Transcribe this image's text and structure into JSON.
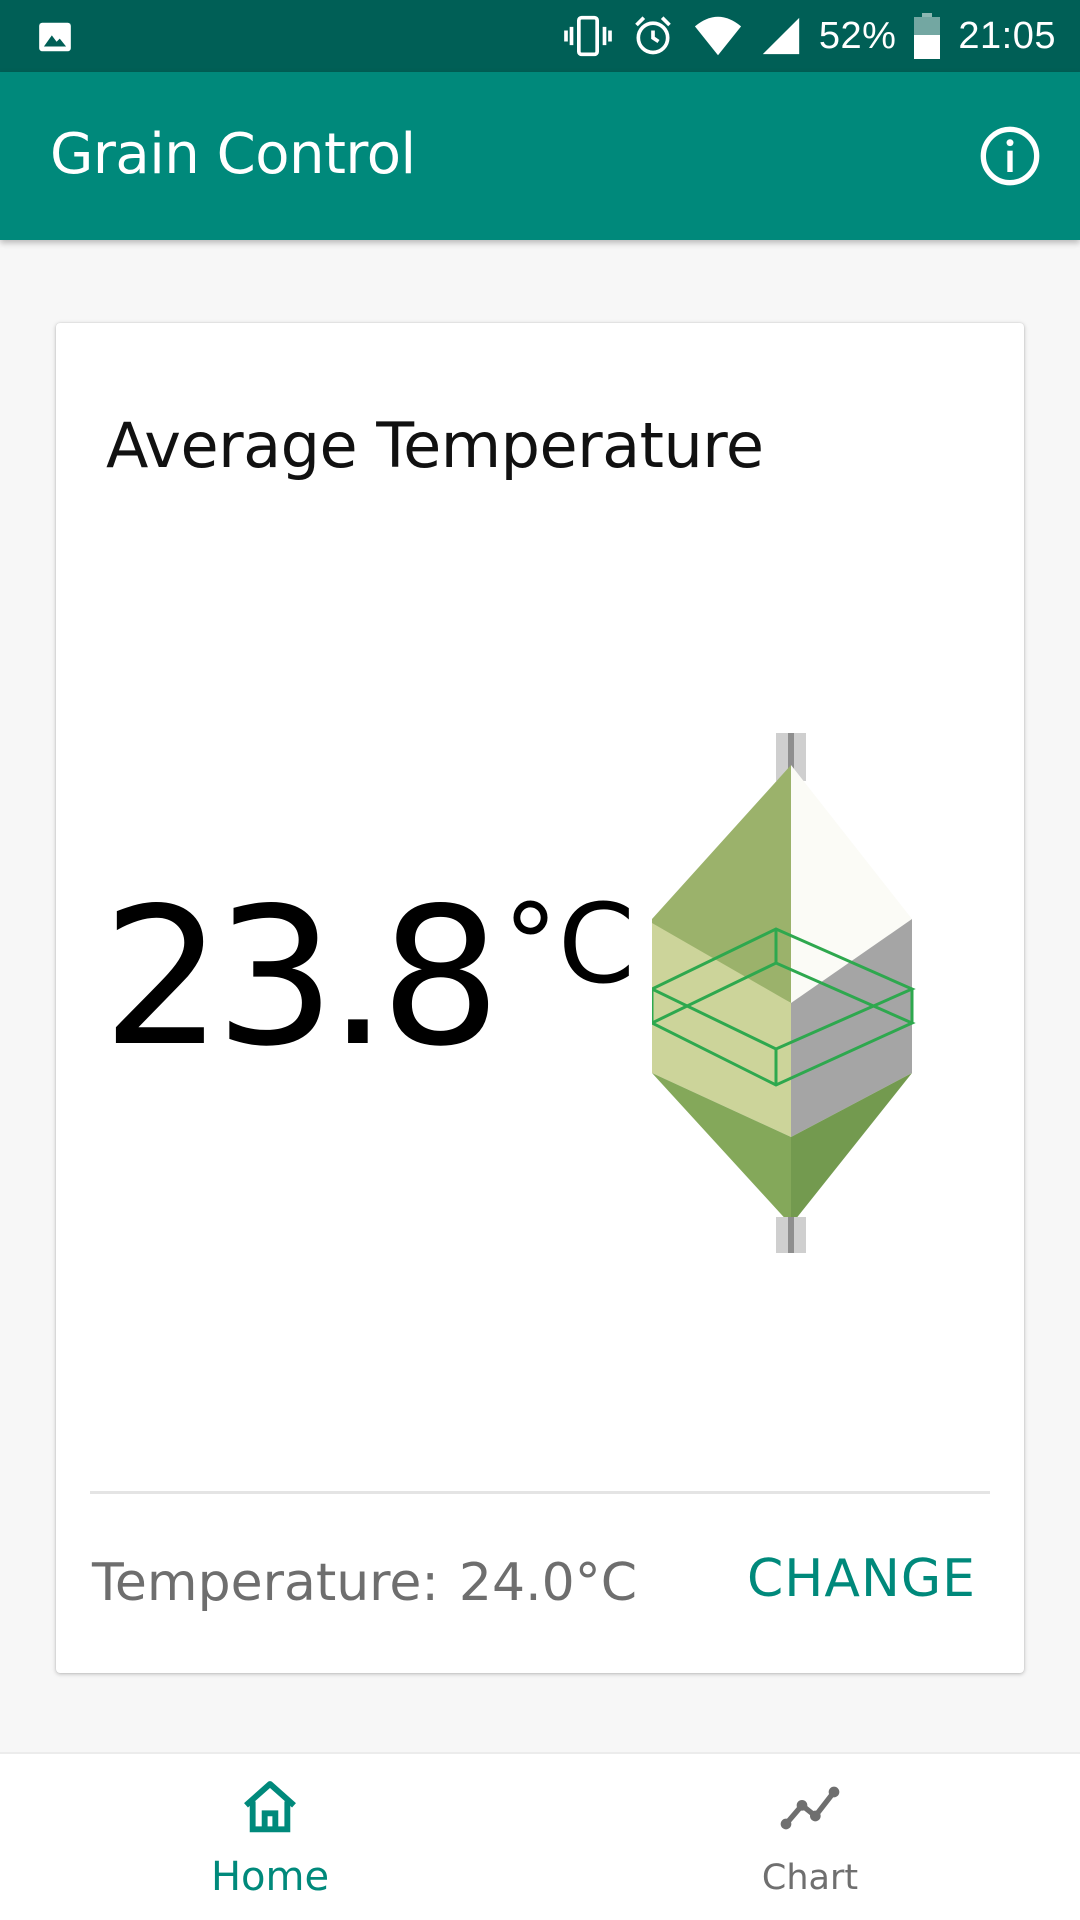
{
  "status_bar": {
    "battery": "52%",
    "time": "21:05",
    "icons": [
      "image-icon",
      "vibrate-icon",
      "alarm-icon",
      "wifi-icon",
      "signal-icon",
      "battery-icon"
    ]
  },
  "app_bar": {
    "title": "Grain Control",
    "info_icon": "info-icon"
  },
  "card": {
    "title": "Average Temperature",
    "avg_value": "23.8",
    "avg_unit": "°C",
    "setting_label": "Temperature:",
    "setting_value": "24.0°C",
    "change_label": "CHANGE",
    "figure": "grain-bin-icon"
  },
  "bottom_nav": {
    "items": [
      {
        "label": "Home",
        "icon": "home-icon",
        "active": true
      },
      {
        "label": "Chart",
        "icon": "chart-icon",
        "active": false
      }
    ]
  },
  "colors": {
    "status_bar": "#005f56",
    "app_bar": "#00897b",
    "accent": "#00897b",
    "background": "#f7f7f7"
  }
}
